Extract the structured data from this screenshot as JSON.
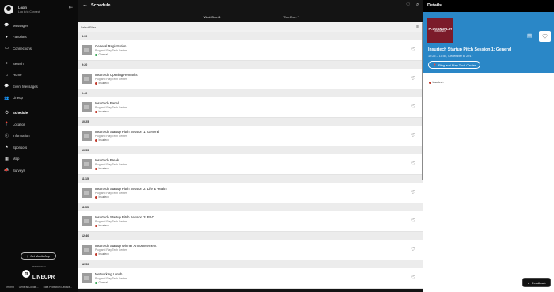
{
  "sidebar": {
    "login_label": "Login",
    "login_sub": "Log in to Connect",
    "collapse_icon": "collapse-left-icon",
    "items": [
      {
        "label": "Messages",
        "icon": "chat-icon",
        "glyph": "💬"
      },
      {
        "label": "Favorites",
        "icon": "heart-icon",
        "glyph": "♥"
      },
      {
        "label": "Connections",
        "icon": "connections-icon",
        "glyph": "▭"
      },
      {
        "label": "Search",
        "icon": "search-icon",
        "glyph": "⌕"
      },
      {
        "label": "Home",
        "icon": "home-icon",
        "glyph": "⌂"
      },
      {
        "label": "Event Messages",
        "icon": "chat-icon",
        "glyph": "💬"
      },
      {
        "label": "Lineup",
        "icon": "people-icon",
        "glyph": "👥"
      },
      {
        "label": "Schedule",
        "icon": "clock-icon",
        "glyph": "◷"
      },
      {
        "label": "Location",
        "icon": "pin-icon",
        "glyph": "📍"
      },
      {
        "label": "Information",
        "icon": "info-icon",
        "glyph": "ⓘ"
      },
      {
        "label": "Sponsors",
        "icon": "star-icon",
        "glyph": "★"
      },
      {
        "label": "Map",
        "icon": "map-icon",
        "glyph": "▦"
      },
      {
        "label": "Surveys",
        "icon": "megaphone-icon",
        "glyph": "📣"
      }
    ],
    "active_index": 7,
    "mobile_button": "Get Mobile App",
    "brand_powered": "POWERED BY",
    "brand_name": "LINEUPR",
    "footer_links": [
      "Imprint",
      "General Conditi...",
      "Data Protection Declara..."
    ]
  },
  "main": {
    "title": "Schedule",
    "tabs": [
      "Wed. Dec. 6",
      "Thu. Dec. 7"
    ],
    "active_tab": 0,
    "filter_placeholder": "Select Filter",
    "schedule": [
      {
        "time": "8:00",
        "sessions": [
          {
            "title": "General Registration",
            "location": "Plug and Play Tech Center",
            "tag": "General",
            "tag_color": "#3aa757"
          }
        ]
      },
      {
        "time": "9:20",
        "sessions": [
          {
            "title": "Insurtech Opening Remarks",
            "location": "Plug and Play Tech Center",
            "tag": "Insurtech",
            "tag_color": "#c0392b"
          }
        ]
      },
      {
        "time": "9:40",
        "sessions": [
          {
            "title": "Insurtech Panel",
            "location": "Plug and Play Tech Center",
            "tag": "Insurtech",
            "tag_color": "#c0392b"
          }
        ]
      },
      {
        "time": "10:25",
        "sessions": [
          {
            "title": "Insurtech Startup Pitch Session 1: General",
            "location": "Plug and Play Tech Center",
            "tag": "Insurtech",
            "tag_color": "#c0392b"
          }
        ]
      },
      {
        "time": "10:55",
        "sessions": [
          {
            "title": "Insurtech Break",
            "location": "Plug and Play Tech Center",
            "tag": "Insurtech",
            "tag_color": "#c0392b"
          }
        ]
      },
      {
        "time": "11:15",
        "sessions": [
          {
            "title": "Insurtech Startup Pitch Session 2: Life & Health",
            "location": "Plug and Play Tech Center",
            "tag": "Insurtech",
            "tag_color": "#c0392b"
          }
        ]
      },
      {
        "time": "11:55",
        "sessions": [
          {
            "title": "Insurtech Startup Pitch Session 3: P&C",
            "location": "Plug and Play Tech Center",
            "tag": "Insurtech",
            "tag_color": "#c0392b"
          }
        ]
      },
      {
        "time": "12:40",
        "sessions": [
          {
            "title": "Insurtech Startup Winner Announcement",
            "location": "Plug and Play Tech Center",
            "tag": "Insurtech",
            "tag_color": "#c0392b"
          }
        ]
      },
      {
        "time": "12:50",
        "sessions": [
          {
            "title": "Networking Lunch",
            "location": "Plug and Play Tech Center",
            "tag": "General",
            "tag_color": "#3aa757"
          }
        ]
      }
    ]
  },
  "details": {
    "header": "Details",
    "logo_text": "PLUGANDPLAY",
    "logo_sub": "INSURTECH",
    "session_title": "Insurtech Startup Pitch Session 1: General",
    "session_time": "10:25 – 10:55, December 6, 2017",
    "location": "Plug and Play Tech Center",
    "tag": "Insurtech",
    "tag_color": "#c0392b",
    "banner_color": "#2a87c7"
  },
  "feedback_button": "Feedback"
}
